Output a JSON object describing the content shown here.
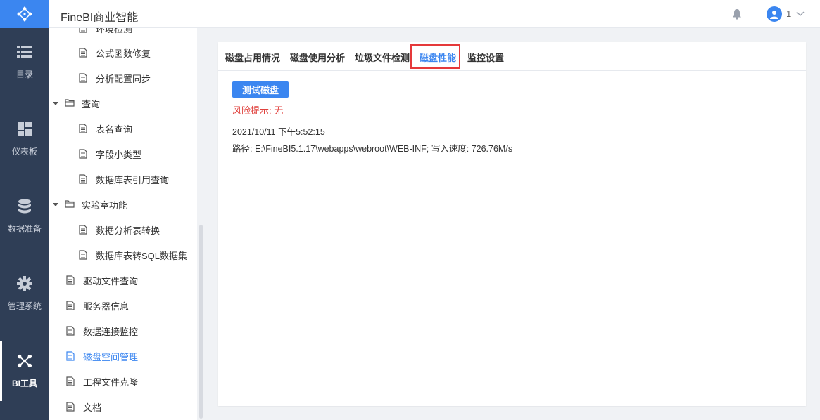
{
  "app": {
    "title": "FineBI商业智能"
  },
  "user": {
    "name": "1"
  },
  "nav": {
    "items": [
      {
        "label": "目录",
        "icon": "list-icon"
      },
      {
        "label": "仪表板",
        "icon": "dashboard-icon"
      },
      {
        "label": "数据准备",
        "icon": "database-icon"
      },
      {
        "label": "管理系统",
        "icon": "gear-icon"
      },
      {
        "label": "BI工具",
        "icon": "bi-tools-icon"
      }
    ]
  },
  "tree": {
    "items": [
      {
        "label": "环境检测",
        "type": "file"
      },
      {
        "label": "公式函数修复",
        "type": "file"
      },
      {
        "label": "分析配置同步",
        "type": "file"
      },
      {
        "label": "查询",
        "type": "folder"
      },
      {
        "label": "表名查询",
        "type": "file"
      },
      {
        "label": "字段小类型",
        "type": "file"
      },
      {
        "label": "数据库表引用查询",
        "type": "file"
      },
      {
        "label": "实验室功能",
        "type": "folder"
      },
      {
        "label": "数据分析表转换",
        "type": "file"
      },
      {
        "label": "数据库表转SQL数据集",
        "type": "file"
      },
      {
        "label": "驱动文件查询",
        "type": "file"
      },
      {
        "label": "服务器信息",
        "type": "file"
      },
      {
        "label": "数据连接监控",
        "type": "file"
      },
      {
        "label": "磁盘空间管理",
        "type": "file",
        "selected": true
      },
      {
        "label": "工程文件克隆",
        "type": "file"
      },
      {
        "label": "文档",
        "type": "file"
      }
    ]
  },
  "tabs": [
    {
      "label": "磁盘占用情况"
    },
    {
      "label": "磁盘使用分析"
    },
    {
      "label": "垃圾文件检测"
    },
    {
      "label": "磁盘性能",
      "active": true
    },
    {
      "label": "监控设置"
    }
  ],
  "content": {
    "test_button": "测试磁盘",
    "risk_text": "风险提示: 无",
    "timestamp": "2021/10/11 下午5:52:15",
    "path_line": "路径: E:\\FineBI5.1.17\\webapps\\webroot\\WEB-INF; 写入速度: 726.76M/s"
  },
  "colors": {
    "nav_bg": "#2f3e56",
    "accent": "#3b86f0",
    "risk": "#e0423e",
    "highlight_box": "#e5393a"
  }
}
